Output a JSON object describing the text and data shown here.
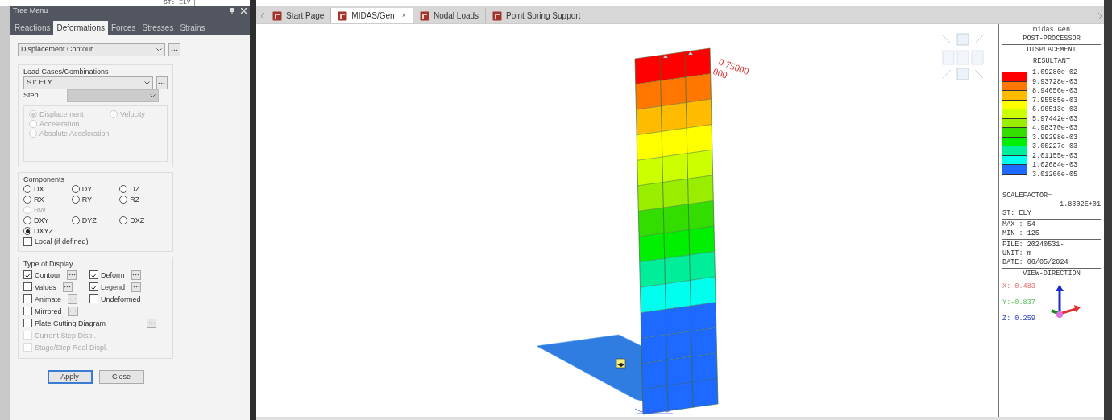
{
  "background_window": {
    "text": "ST: ELY"
  },
  "tree_menu": {
    "title": "Tree Menu",
    "tabs": [
      {
        "label": "Reactions",
        "selected": false
      },
      {
        "label": "Deformations",
        "selected": true
      },
      {
        "label": "Forces",
        "selected": false
      },
      {
        "label": "Stresses",
        "selected": false
      },
      {
        "label": "Strains",
        "selected": false
      }
    ],
    "result_type": {
      "value": "Displacement Contour"
    },
    "load_cases": {
      "label": "Load Cases/Combinations",
      "value": "ST: ELY",
      "step_label": "Step",
      "step_disabled": true,
      "options": [
        {
          "label": "Displacement",
          "selected": true,
          "disabled": true
        },
        {
          "label": "Velocity",
          "selected": false,
          "disabled": true
        },
        {
          "label": "Acceleration",
          "selected": false,
          "disabled": true
        },
        {
          "label": "Absolute Acceleration",
          "selected": false,
          "disabled": true
        }
      ]
    },
    "components": {
      "label": "Components",
      "rows": [
        {
          "items": [
            {
              "label": "DX",
              "selected": false,
              "disabled": false
            },
            {
              "label": "DY",
              "selected": false,
              "disabled": false
            },
            {
              "label": "DZ",
              "selected": false,
              "disabled": false
            }
          ]
        },
        {
          "items": [
            {
              "label": "RX",
              "selected": false,
              "disabled": false
            },
            {
              "label": "RY",
              "selected": false,
              "disabled": false
            },
            {
              "label": "RZ",
              "selected": false,
              "disabled": false
            }
          ]
        },
        {
          "items": [
            {
              "label": "RW",
              "selected": false,
              "disabled": true
            }
          ]
        },
        {
          "items": [
            {
              "label": "DXY",
              "selected": false,
              "disabled": false
            },
            {
              "label": "DYZ",
              "selected": false,
              "disabled": false
            },
            {
              "label": "DXZ",
              "selected": false,
              "disabled": false
            }
          ]
        },
        {
          "items": [
            {
              "label": "DXYZ",
              "selected": true,
              "disabled": false
            }
          ]
        }
      ],
      "local": {
        "label": "Local (if defined)",
        "checked": false
      }
    },
    "display": {
      "label": "Type of Display",
      "rows": [
        {
          "items": [
            {
              "label": "Contour",
              "checked": true,
              "disabled": false,
              "options": true
            },
            {
              "label": "Deform",
              "checked": true,
              "disabled": false,
              "options": true
            }
          ]
        },
        {
          "items": [
            {
              "label": "Values",
              "checked": false,
              "disabled": false,
              "options": true
            },
            {
              "label": "Legend",
              "checked": true,
              "disabled": false,
              "options": true
            }
          ]
        },
        {
          "items": [
            {
              "label": "Animate",
              "checked": false,
              "disabled": false,
              "options": true
            },
            {
              "label": "Undeformed",
              "checked": false,
              "disabled": false,
              "options": false
            }
          ]
        },
        {
          "items": [
            {
              "label": "Mirrored",
              "checked": false,
              "disabled": false,
              "options": true
            }
          ]
        },
        {
          "items": [
            {
              "label": "Plate Cutting Diagram",
              "checked": false,
              "disabled": false,
              "options": true
            }
          ]
        },
        {
          "items": [
            {
              "label": "Current Step Displ.",
              "checked": false,
              "disabled": true,
              "options": false
            }
          ]
        },
        {
          "items": [
            {
              "label": "Stage/Step Real Displ.",
              "checked": false,
              "disabled": true,
              "options": false
            }
          ]
        }
      ]
    },
    "buttons": [
      {
        "label": "Apply",
        "default": true
      },
      {
        "label": "Close",
        "default": false
      }
    ]
  },
  "doc_tabs": [
    {
      "label": "Start Page",
      "selected": false
    },
    {
      "label": "MIDAS/Gen",
      "selected": true,
      "close": "×"
    },
    {
      "label": "Nodal Loads",
      "selected": false
    },
    {
      "label": "Point Spring Support",
      "selected": false
    }
  ],
  "model_labels": [
    "0.75000",
    "000"
  ],
  "legend": {
    "header": [
      "midas Gen",
      "POST-PROCESSOR"
    ],
    "type": "DISPLACEMENT",
    "component": "RESULTANT",
    "items": [
      {
        "value": "1.09280e-02",
        "color": "#ff0000"
      },
      {
        "value": "9.93728e-03",
        "color": "#ff7700"
      },
      {
        "value": "8.94656e-03",
        "color": "#ffbb00"
      },
      {
        "value": "7.95585e-03",
        "color": "#ffff00"
      },
      {
        "value": "6.96513e-03",
        "color": "#ccff00"
      },
      {
        "value": "5.97442e-03",
        "color": "#99ee00"
      },
      {
        "value": "4.98370e-03",
        "color": "#33dd00"
      },
      {
        "value": "3.99298e-03",
        "color": "#00ee00"
      },
      {
        "value": "3.00227e-03",
        "color": "#00ee99"
      },
      {
        "value": "2.01155e-03",
        "color": "#00ffee"
      },
      {
        "value": "1.02084e-03",
        "color": "#1e69ff"
      },
      {
        "value": "3.01206e-05"
      }
    ],
    "scale_label": "SCALEFACTOR=",
    "scale_value": "1.8302E+01",
    "load_case": "ST: ELY",
    "max": "MAX : 54",
    "min": "MIN : 125",
    "file": "FILE: 20240531-",
    "unit": "UNIT: m",
    "date": "DATE: 06/05/2024",
    "view_title": "VIEW-DIRECTION",
    "view": [
      {
        "text": "X:-0.483",
        "kind": "x"
      },
      {
        "text": "Y:-0.837",
        "kind": "y"
      },
      {
        "text": "Z: 0.259",
        "kind": "z"
      }
    ]
  }
}
